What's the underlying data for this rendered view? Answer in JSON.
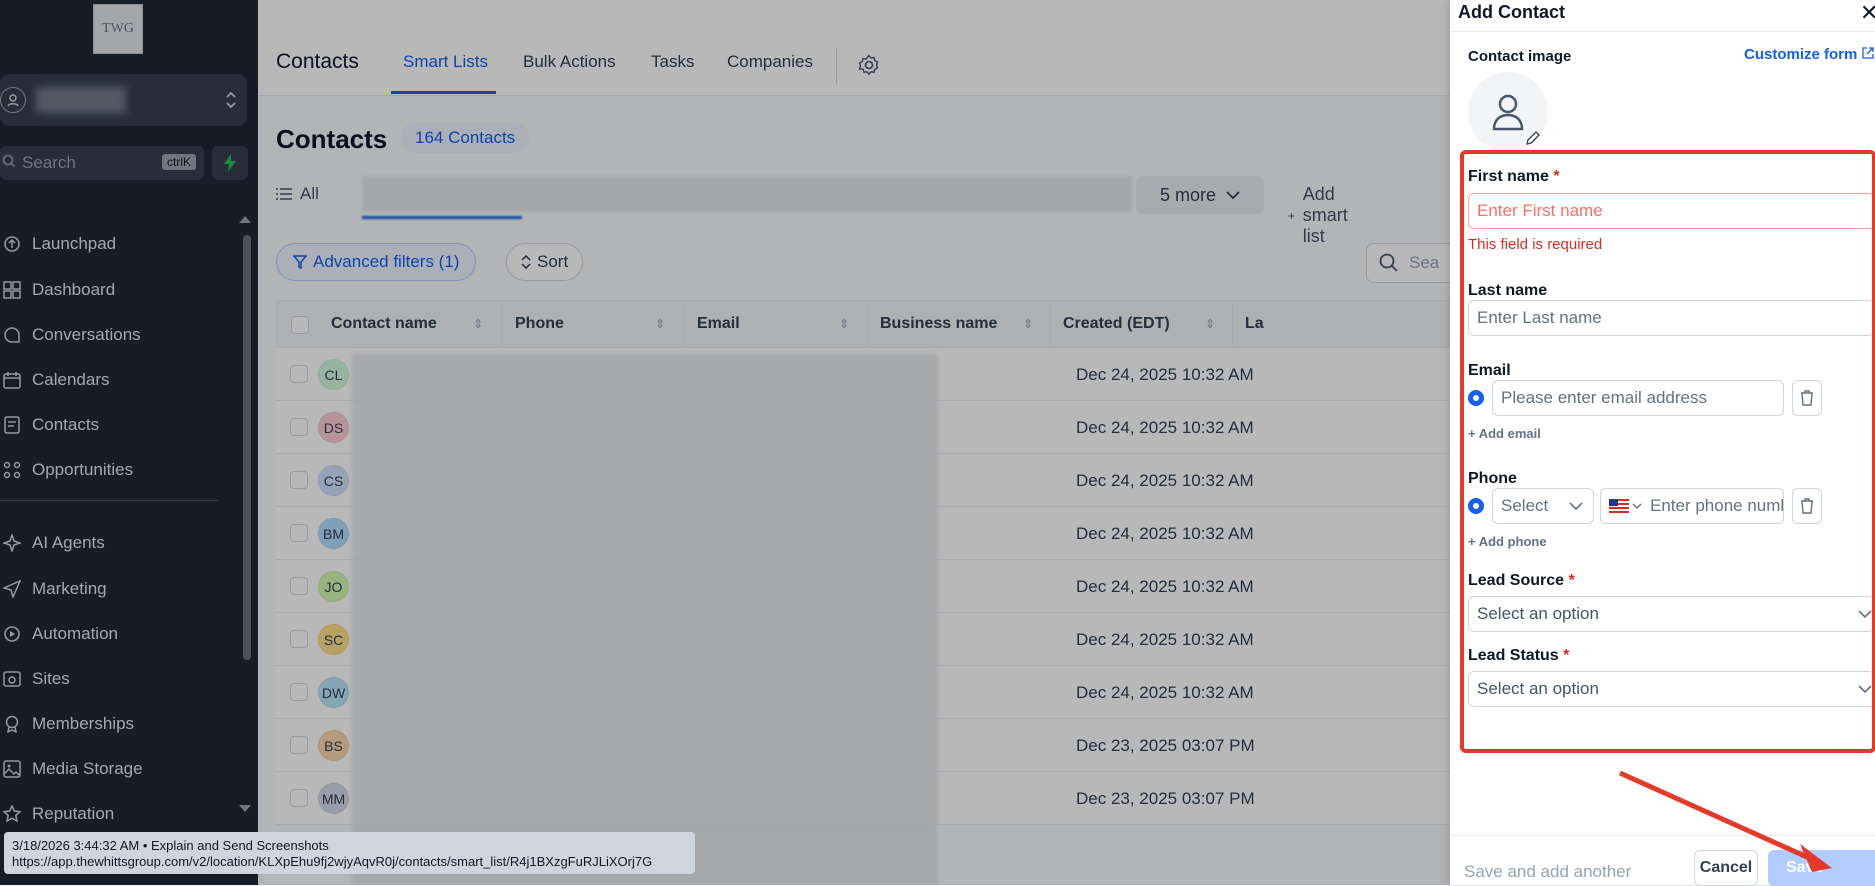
{
  "sidebar": {
    "logo_text": "TWG",
    "search_placeholder": "Search",
    "search_shortcut": "ctrlK",
    "items": [
      {
        "label": "Launchpad",
        "icon": "rocket-icon"
      },
      {
        "label": "Dashboard",
        "icon": "grid-icon"
      },
      {
        "label": "Conversations",
        "icon": "chat-icon"
      },
      {
        "label": "Calendars",
        "icon": "calendar-icon"
      },
      {
        "label": "Contacts",
        "icon": "contact-book-icon"
      },
      {
        "label": "Opportunities",
        "icon": "opportunities-icon"
      },
      {
        "label": "AI Agents",
        "icon": "sparkle-icon"
      },
      {
        "label": "Marketing",
        "icon": "send-icon"
      },
      {
        "label": "Automation",
        "icon": "automation-icon"
      },
      {
        "label": "Sites",
        "icon": "sites-icon"
      },
      {
        "label": "Memberships",
        "icon": "award-icon"
      },
      {
        "label": "Media Storage",
        "icon": "image-icon"
      },
      {
        "label": "Reputation",
        "icon": "star-icon"
      }
    ]
  },
  "topnav": {
    "title": "Contacts",
    "tabs": [
      "Smart Lists",
      "Bulk Actions",
      "Tasks",
      "Companies"
    ],
    "active_tab": "Smart Lists"
  },
  "main": {
    "heading": "Contacts",
    "count_badge": "164 Contacts",
    "all_label": "All",
    "more_label": "5 more",
    "add_smart_list": "Add smart list",
    "filters_label": "Advanced filters (1)",
    "sort_label": "Sort",
    "search_placeholder": "Sea",
    "columns": [
      "Contact name",
      "Phone",
      "Email",
      "Business name",
      "Created (EDT)",
      "La"
    ],
    "rows": [
      {
        "initials": "CL",
        "created": "Dec 24, 2025 10:32 AM",
        "color": "#d1fadf"
      },
      {
        "initials": "DS",
        "created": "Dec 24, 2025 10:32 AM",
        "color": "#fecdd6"
      },
      {
        "initials": "CS",
        "created": "Dec 24, 2025 10:32 AM",
        "color": "#d1e0ff"
      },
      {
        "initials": "BM",
        "created": "Dec 24, 2025 10:32 AM",
        "color": "#b2ddff"
      },
      {
        "initials": "JO",
        "created": "Dec 24, 2025 10:32 AM",
        "color": "#d3f8b2"
      },
      {
        "initials": "SC",
        "created": "Dec 24, 2025 10:32 AM",
        "color": "#fedf89"
      },
      {
        "initials": "DW",
        "created": "Dec 24, 2025 10:32 AM",
        "color": "#b9e6fe"
      },
      {
        "initials": "BS",
        "created": "Dec 23, 2025 03:07 PM",
        "color": "#fdd6ae"
      },
      {
        "initials": "MM",
        "created": "Dec 23, 2025 03:07 PM",
        "color": "#d5d9eb"
      }
    ]
  },
  "drawer": {
    "title": "Add Contact",
    "contact_image_label": "Contact image",
    "customize_form": "Customize form",
    "first_name_label": "First name",
    "required_mark": "*",
    "first_name_placeholder": "Enter First name",
    "error_message": "This field is required",
    "last_name_label": "Last name",
    "last_name_placeholder": "Enter Last name",
    "email_label": "Email",
    "email_placeholder": "Please enter email address",
    "add_email": "+ Add email",
    "phone_label": "Phone",
    "phone_type_placeholder": "Select",
    "phone_placeholder": "Enter phone number",
    "add_phone": "+ Add phone",
    "lead_source_label": "Lead Source",
    "lead_source_placeholder": "Select an option",
    "lead_status_label": "Lead Status",
    "lead_status_placeholder": "Select an option",
    "save_and_add_another": "Save and add another",
    "cancel": "Cancel",
    "save": "Save"
  },
  "tooltip": {
    "line1": "3/18/2026 3:44:32 AM • Explain and Send Screenshots",
    "line2": "https://app.thewhittsgroup.com/v2/location/KLXpEhu9fj2wjyAqvR0j/contacts/smart_list/R4j1BXzgFuRJLiXOrj7G"
  },
  "colors": {
    "accent": "#155eef",
    "error": "#d92d20",
    "annotation": "#e5392b"
  }
}
